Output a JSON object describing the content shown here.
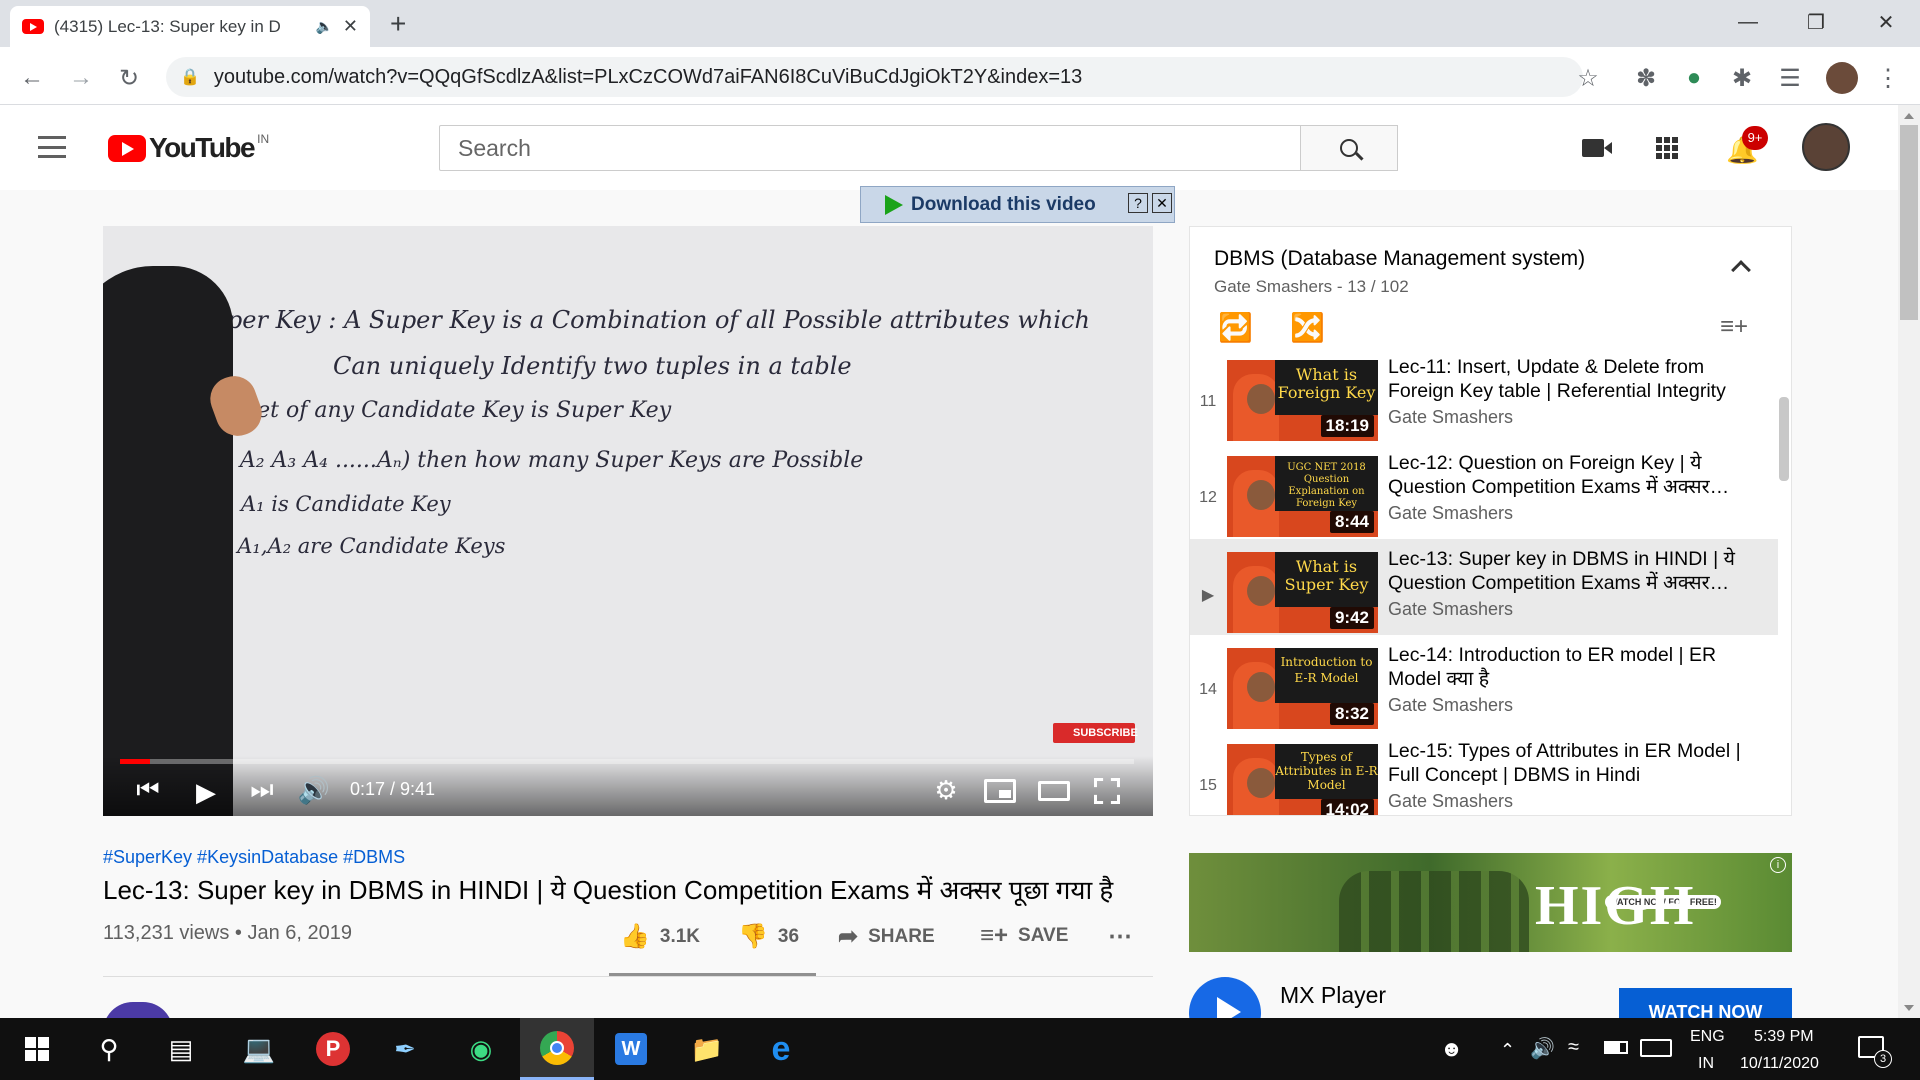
{
  "browser": {
    "tab_title": "(4315) Lec-13: Super key in D",
    "url": "youtube.com/watch?v=QQqGfScdlzA&list=PLxCzCOWd7aiFAN6I8CuViBuCdJgiOkT2Y&index=13"
  },
  "youtube": {
    "logo_text": "YouTube",
    "region": "IN",
    "search_placeholder": "Search",
    "notification_count": "9+",
    "download_bar": "Download this video"
  },
  "player": {
    "time": "0:17 / 9:41",
    "progress_fraction": 0.03,
    "subscribe_badge": "SUBSCRIBE",
    "board_lines": [
      "*Super Key :  A  Super Key  is a Combination  of all  Possible  attributes  which",
      "Can  uniquely  Identify  two  tuples  in a table",
      "*Superset  of any  Candidate Key  is  Super Key",
      "R(A₁ A₂ A₃ A₄ ......Aₙ)  then  how many  Super Keys  are  Possible",
      "A₁  is  Candidate Key",
      "→ A₁,A₂  are  Candidate Keys"
    ]
  },
  "video": {
    "tags": "#SuperKey #KeysinDatabase #DBMS",
    "title": "Lec-13: Super key in DBMS in HINDI | ये Question Competition Exams में अक्सर पूछा गया है",
    "views_date": "113,231 views • Jan 6, 2019",
    "likes": "3.1K",
    "dislikes": "36",
    "share": "SHARE",
    "save": "SAVE"
  },
  "playlist": {
    "title": "DBMS (Database Management system)",
    "subtitle": "Gate Smashers - 13 / 102",
    "items": [
      {
        "index": "11",
        "title": "Lec-11: Insert, Update & Delete from Foreign Key table | Referential Integrity",
        "channel": "Gate Smashers",
        "duration": "18:19",
        "thumb": "What is Foreign Key"
      },
      {
        "index": "12",
        "title": "Lec-12: Question on Foreign Key | ये Question Competition Exams में अक्सर…",
        "channel": "Gate Smashers",
        "duration": "8:44",
        "thumb": "UGC NET 2018 Question Explanation on Foreign Key"
      },
      {
        "index": "▶",
        "title": "Lec-13: Super key in DBMS in HINDI | ये Question Competition Exams में अक्सर…",
        "channel": "Gate Smashers",
        "duration": "9:42",
        "thumb": "What is Super Key"
      },
      {
        "index": "14",
        "title": "Lec-14: Introduction to ER model | ER Model क्या है",
        "channel": "Gate Smashers",
        "duration": "8:32",
        "thumb": "Introduction to E-R Model"
      },
      {
        "index": "15",
        "title": "Lec-15: Types of Attributes in ER Model | Full Concept | DBMS in Hindi",
        "channel": "Gate Smashers",
        "duration": "14:02",
        "thumb": "Types of Attributes in E-R Model"
      }
    ]
  },
  "ad": {
    "banner_text": "HIGH",
    "banner_badge": "WATCH NOW FOR FREE!",
    "advertiser": "MX Player",
    "cta": "WATCH NOW"
  },
  "taskbar": {
    "lang_top": "ENG",
    "lang_bottom": "IN",
    "time": "5:39 PM",
    "date": "10/11/2020",
    "notif_count": "3"
  }
}
